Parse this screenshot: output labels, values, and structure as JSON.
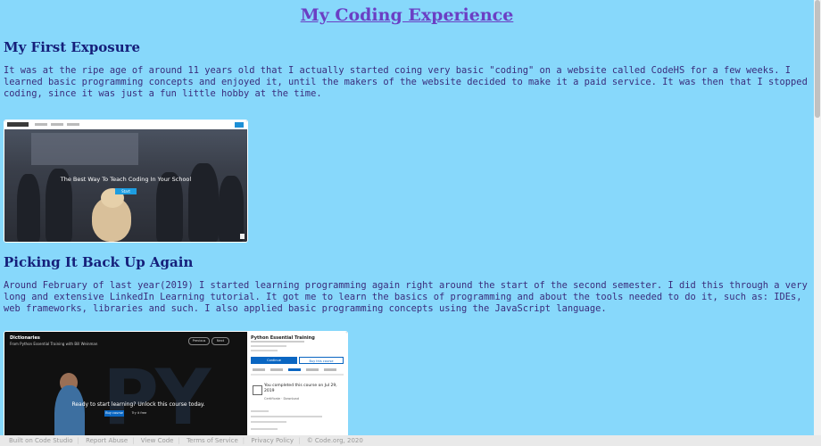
{
  "page": {
    "title": "My Coding Experience",
    "sections": [
      {
        "heading": "My First Exposure",
        "text": "It was at the ripe age of around 11 years old that I actually started coing very basic \"coding\" on a website called CodeHS for a few weeks. I learned basic programming concepts and enjoyed it, until the makers of the website decided to make it a paid service. It was then that I stopped coding, since it was just a fun little hobby at the time."
      },
      {
        "heading": "Picking It Back Up Again",
        "text": "Around February of last year(2019) I started learning programming again right around the start of the second semester. I did this through a very long and extensive LinkedIn Learning tutorial. It got me to learn the basics of programming and about the tools needed to do it, such as: IDEs, web frameworks, libraries and such. I also applied basic programming concepts using the JavaScript language."
      }
    ]
  },
  "screenshot1": {
    "headline": "The Best Way To Teach Coding In Your School",
    "cta": "Start"
  },
  "screenshot2": {
    "video_title": "Dictionaries",
    "video_subtitle": "From Python Essential Training with Bill Weinman",
    "ctrl_prev": "Previous",
    "ctrl_next": "Next",
    "watermark": "PY",
    "message": "Ready to start learning? Unlock this course today.",
    "btn_primary": "Buy course",
    "btn_secondary": "Try it free",
    "sidebar_title": "Python Essential Training",
    "btn_continue": "Continue",
    "btn_playlist": "Buy this course",
    "completed_text": "You completed this course on Jul 29, 2019",
    "completed_sub": "Certificate · Download"
  },
  "footer": {
    "links": [
      "Built on Code Studio",
      "Report Abuse",
      "View Code",
      "Terms of Service",
      "Privacy Policy",
      "© Code.org, 2020"
    ]
  }
}
